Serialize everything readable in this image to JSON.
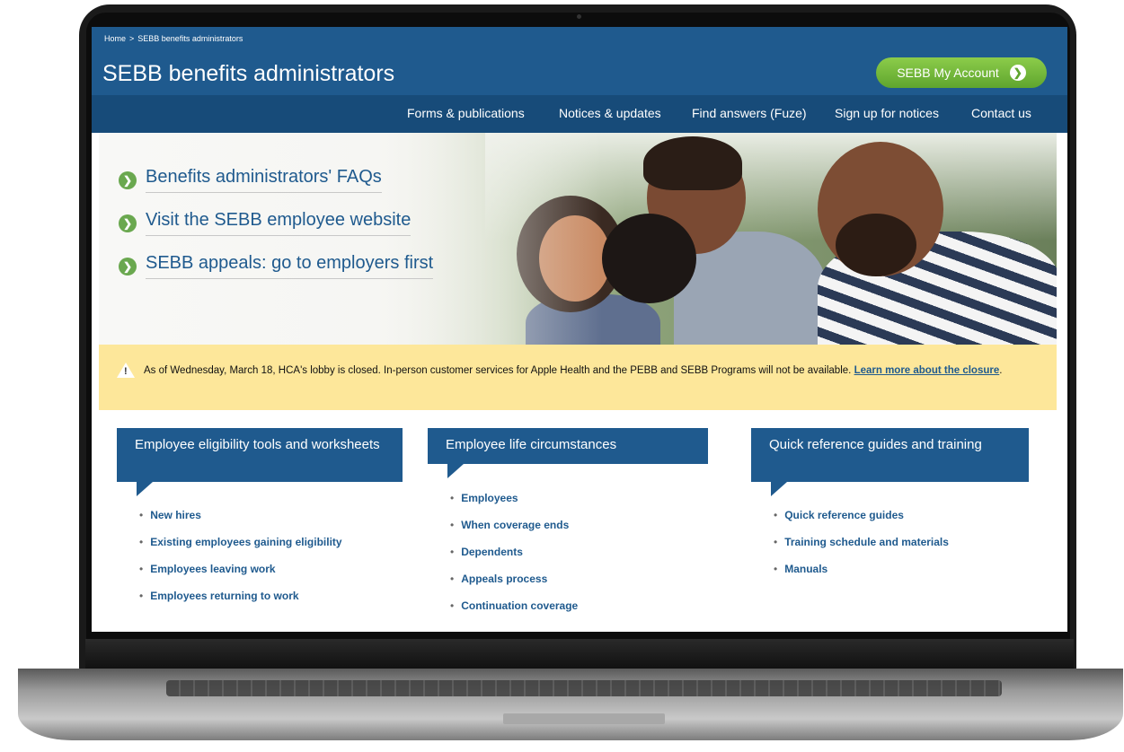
{
  "breadcrumb": {
    "home": "Home",
    "separator": ">",
    "current": "SEBB benefits administrators"
  },
  "page_title": "SEBB benefits administrators",
  "account_button": {
    "label": "SEBB My Account",
    "arrow": "❯"
  },
  "nav": [
    "Forms & publications",
    "Notices & updates",
    "Find answers (Fuze)",
    "Sign up for notices",
    "Contact us"
  ],
  "hero_links": [
    "Benefits administrators' FAQs",
    "Visit the SEBB employee website",
    "SEBB appeals: go to employers first"
  ],
  "alert": {
    "icon": "warning-icon",
    "text": "As of Wednesday, March 18, HCA's lobby is closed. In-person customer services for Apple Health and the PEBB and SEBB Programs will not be available.",
    "link": "Learn more about the closure",
    "suffix": "."
  },
  "columns": [
    {
      "heading": "Employee eligibility tools and worksheets",
      "items": [
        "New hires",
        "Existing employees gaining eligibility",
        "Employees leaving work",
        "Employees returning to work"
      ]
    },
    {
      "heading": "Employee life circumstances",
      "items": [
        "Employees",
        "When coverage ends",
        "Dependents",
        "Appeals process",
        "Continuation coverage"
      ]
    },
    {
      "heading": "Quick reference guides and training",
      "items": [
        "Quick reference guides",
        "Training schedule and materials",
        "Manuals"
      ]
    }
  ],
  "colors": {
    "brand_blue": "#1f5a8e",
    "nav_blue": "#174b79",
    "account_green": "#6aa84f",
    "alert_yellow": "#fde79a"
  }
}
